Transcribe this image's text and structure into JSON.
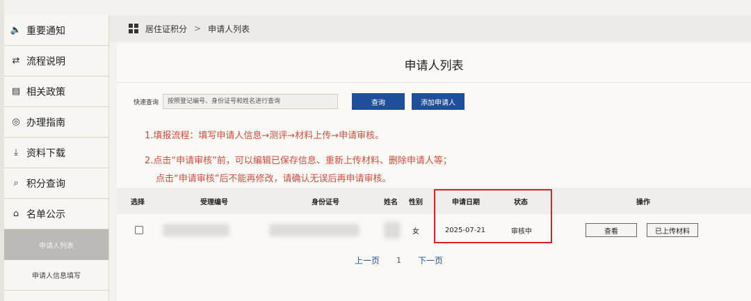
{
  "sidebar": {
    "items": [
      {
        "icon": "speaker-icon",
        "glyph": "🔈",
        "label": "重要通知"
      },
      {
        "icon": "flow-icon",
        "glyph": "⇄",
        "label": "流程说明"
      },
      {
        "icon": "document-icon",
        "glyph": "▤",
        "label": "相关政策"
      },
      {
        "icon": "compass-icon",
        "glyph": "◎",
        "label": "办理指南"
      },
      {
        "icon": "download-icon",
        "glyph": "⤓",
        "label": "资料下载"
      },
      {
        "icon": "search-score-icon",
        "glyph": "⌕",
        "label": "积分查询"
      },
      {
        "icon": "list-public-icon",
        "glyph": "⌂",
        "label": "名单公示"
      }
    ],
    "sub_items": [
      {
        "label": "申请人列表",
        "active": true
      },
      {
        "label": "申请人信息填写",
        "active": false
      }
    ]
  },
  "breadcrumb": {
    "root": "居住证积分",
    "separator": ">",
    "current": "申请人列表"
  },
  "page": {
    "title": "申请人列表"
  },
  "search": {
    "label": "快速查询",
    "placeholder": "按照登记编号、身份证号和姓名进行查询",
    "query_button": "查询",
    "add_button": "添加申请人"
  },
  "notices": {
    "line1": "1.填报流程：填写申请人信息→测评→材料上传→申请审核。",
    "line2": "2.点击“申请审核”前，可以编辑已保存信息、重新上传材料、删除申请人等；",
    "line3": "点击“申请审核”后不能再修改，请确认无误后再申请审核。"
  },
  "table": {
    "headers": {
      "select": "选择",
      "accept_no": "受理编号",
      "id_no": "身份证号",
      "name": "姓名",
      "gender": "性别",
      "apply_date": "申请日期",
      "status": "状态",
      "actions": "操作"
    },
    "rows": [
      {
        "accept_no": "",
        "id_no": "",
        "name": "",
        "gender": "女",
        "apply_date": "2025-07-21",
        "status": "审核中",
        "view_button": "查看",
        "uploaded_button": "已上传材料"
      }
    ]
  },
  "pager": {
    "prev": "上一页",
    "page": "1",
    "next": "下一页"
  },
  "colors": {
    "primary_button": "#1f4f9a",
    "notice_text": "#d64c3d",
    "highlight_box": "#e02020"
  }
}
